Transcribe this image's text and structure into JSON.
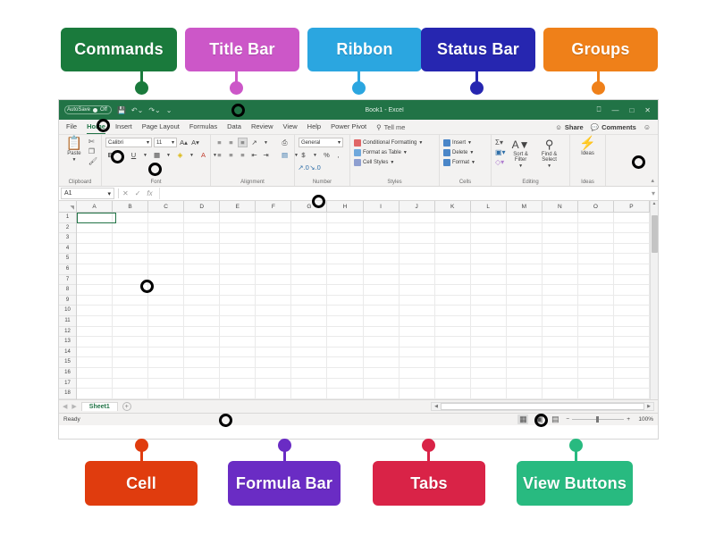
{
  "callouts": {
    "top": [
      {
        "label": "Commands",
        "color": "#1a7a3c"
      },
      {
        "label": "Title Bar",
        "color": "#cc57c8"
      },
      {
        "label": "Ribbon",
        "color": "#2ba6e0"
      },
      {
        "label": "Status Bar",
        "color": "#2626b0"
      },
      {
        "label": "Groups",
        "color": "#ef8019"
      }
    ],
    "bottom": [
      {
        "label": "Cell",
        "color": "#e03c0e"
      },
      {
        "label": "Formula Bar",
        "color": "#6a2cc4"
      },
      {
        "label": "Tabs",
        "color": "#d92347"
      },
      {
        "label": "View Buttons",
        "color": "#28ba80"
      }
    ]
  },
  "excel": {
    "titlebar": {
      "autosave_label": "AutoSave",
      "autosave_state": "Off",
      "save_icon": "save-icon",
      "undo_icon": "undo-icon",
      "redo_icon": "redo-icon",
      "qat_more_icon": "qat-dropdown-icon",
      "document_title": "Book1 - Excel",
      "ribbon_display_icon": "ribbon-display-options-icon",
      "minimize_icon": "minimize-icon",
      "maximize_icon": "maximize-icon",
      "close_icon": "close-icon"
    },
    "tabs": [
      {
        "label": "File",
        "active": false
      },
      {
        "label": "Home",
        "active": true
      },
      {
        "label": "Insert",
        "active": false
      },
      {
        "label": "Page Layout",
        "active": false
      },
      {
        "label": "Formulas",
        "active": false
      },
      {
        "label": "Data",
        "active": false
      },
      {
        "label": "Review",
        "active": false
      },
      {
        "label": "View",
        "active": false
      },
      {
        "label": "Help",
        "active": false
      },
      {
        "label": "Power Pivot",
        "active": false
      }
    ],
    "tellme": "Tell me",
    "share_label": "Share",
    "comments_label": "Comments",
    "ribbon_groups": [
      {
        "name": "Clipboard",
        "paste_label": "Paste",
        "items": [
          "Cut",
          "Copy",
          "Format Painter"
        ]
      },
      {
        "name": "Font",
        "font_name": "Calibri",
        "font_size": "11",
        "grow_font": "A",
        "shrink_font": "A",
        "bold": "B",
        "italic": "I",
        "underline": "U",
        "borders": "borders-icon",
        "fill_color": "fill-color-icon",
        "font_color": "font-color-icon"
      },
      {
        "name": "Alignment",
        "items": [
          "Top Align",
          "Middle Align",
          "Bottom Align",
          "Orientation",
          "Align Left",
          "Center",
          "Align Right",
          "Decrease Indent",
          "Increase Indent",
          "Wrap Text",
          "Merge & Center"
        ]
      },
      {
        "name": "Number",
        "format": "General",
        "currency": "$",
        "percent": "%",
        "comma": ",",
        "increase_decimal": "increase-decimal-icon",
        "decrease_decimal": "decrease-decimal-icon"
      },
      {
        "name": "Styles",
        "items": [
          "Conditional Formatting",
          "Format as Table",
          "Cell Styles"
        ]
      },
      {
        "name": "Cells",
        "items": [
          "Insert",
          "Delete",
          "Format"
        ]
      },
      {
        "name": "Editing",
        "autosum": "autosum-icon",
        "fill": "fill-icon",
        "clear": "clear-icon",
        "sort_filter": "Sort & Filter",
        "find_select": "Find & Select"
      },
      {
        "name": "Ideas",
        "ideas_label": "Ideas"
      }
    ],
    "collapse_ribbon_icon": "collapse-ribbon-icon",
    "formula_bar": {
      "name_box_value": "A1",
      "name_box_dropdown_icon": "chevron-down-icon",
      "cancel_icon": "cancel-icon",
      "enter_icon": "enter-icon",
      "function_icon": "fx",
      "formula_value": "",
      "expand_icon": "expand-formula-bar-icon"
    },
    "grid": {
      "columns": [
        "A",
        "B",
        "C",
        "D",
        "E",
        "F",
        "G",
        "H",
        "I",
        "J",
        "K",
        "L",
        "M",
        "N",
        "O",
        "P"
      ],
      "rows": [
        "1",
        "2",
        "3",
        "4",
        "5",
        "6",
        "7",
        "8",
        "9",
        "10",
        "11",
        "12",
        "13",
        "14",
        "15",
        "16",
        "17",
        "18"
      ],
      "selected_cell": "A1",
      "select_all_icon": "select-all-corner-icon"
    },
    "sheet_tabs": {
      "prev_icon": "previous-sheet-icon",
      "next_icon": "next-sheet-icon",
      "sheets": [
        "Sheet1"
      ],
      "add_sheet_icon": "add-sheet-icon"
    },
    "statusbar": {
      "status_text": "Ready",
      "view_normal_icon": "normal-view-icon",
      "view_pagelayout_icon": "page-layout-view-icon",
      "view_pagebreak_icon": "page-break-preview-icon",
      "zoom_out": "−",
      "zoom_in": "+",
      "zoom_level": "100%"
    }
  }
}
